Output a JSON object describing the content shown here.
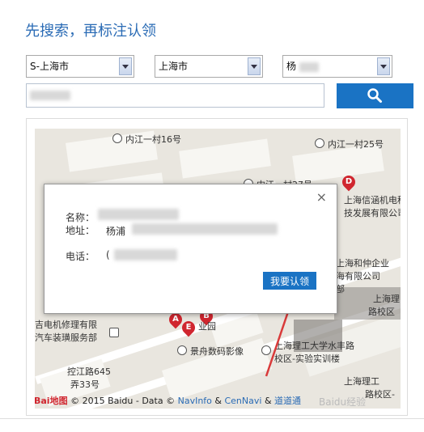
{
  "page_title": "先搜索，再标注认领",
  "selects": {
    "province": "S-上海市",
    "city": "上海市",
    "district": "杨"
  },
  "search": {
    "value": "",
    "button_icon": "search-icon"
  },
  "map": {
    "labels": {
      "l1": "内江一村16号",
      "l2": "内江一村25号",
      "l3": "内江一村27号",
      "l4": "上海信涵机电科",
      "l5": "技发展有限公司",
      "l6": "上海和仲企业",
      "l7": "海有限公司",
      "l8": "部",
      "l9": "上海理",
      "l10": "路校区",
      "l11": "吉电机修理有限",
      "l12": "汽车装璜服务部",
      "l13": "业园",
      "l14": "景舟数码影像",
      "l15": "上海理工大学水丰路",
      "l16": "校区-实验实训楼",
      "l17": "控江路645",
      "l18": "弄33号",
      "l19": "上海理工",
      "l20": "路校区-",
      "l21": "A",
      "l22": "E",
      "l23": "B",
      "l24": "D"
    },
    "footer": {
      "logo": "Bai地图",
      "text": "© 2015 Baidu - Data ©",
      "link1": "NavInfo",
      "amp1": "&",
      "link2": "CenNavi",
      "amp2": "&",
      "link3": "道道通"
    },
    "watermark": "Baidu经验"
  },
  "dialog": {
    "name_label": "名称：",
    "address_label": "地址：",
    "address_value": "杨浦",
    "phone_label": "电话：",
    "phone_value": "(",
    "close": "×",
    "claim_button": "我要认领"
  },
  "colors": {
    "accent": "#1a73c4",
    "title": "#2a6bb5",
    "pin": "#d0262f",
    "arrow": "#d93a3a"
  }
}
